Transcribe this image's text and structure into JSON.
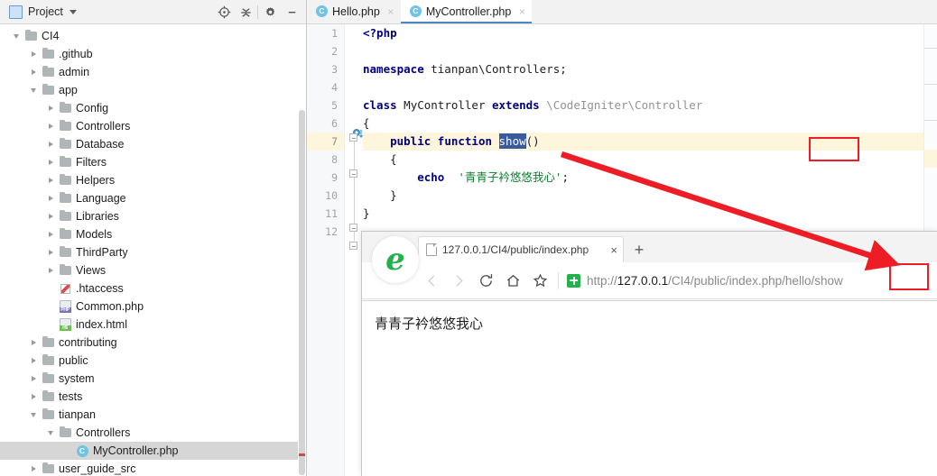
{
  "ide": {
    "sidebar": {
      "panel_title": "Project",
      "toolbar": [
        {
          "name": "locate-icon",
          "tooltip": "Select Opened File"
        },
        {
          "name": "collapse-all-icon",
          "tooltip": "Collapse All"
        },
        {
          "name": "gear-icon",
          "tooltip": "Settings"
        },
        {
          "name": "minimize-icon",
          "tooltip": "Hide"
        }
      ],
      "tree": [
        {
          "label": "CI4",
          "depth": 0,
          "kind": "folder",
          "state": "expanded",
          "selected": false
        },
        {
          "label": ".github",
          "depth": 1,
          "kind": "folder",
          "state": "collapsed",
          "selected": false
        },
        {
          "label": "admin",
          "depth": 1,
          "kind": "folder",
          "state": "collapsed",
          "selected": false
        },
        {
          "label": "app",
          "depth": 1,
          "kind": "folder",
          "state": "expanded",
          "selected": false
        },
        {
          "label": "Config",
          "depth": 2,
          "kind": "folder",
          "state": "collapsed",
          "selected": false
        },
        {
          "label": "Controllers",
          "depth": 2,
          "kind": "folder",
          "state": "collapsed",
          "selected": false
        },
        {
          "label": "Database",
          "depth": 2,
          "kind": "folder",
          "state": "collapsed",
          "selected": false
        },
        {
          "label": "Filters",
          "depth": 2,
          "kind": "folder",
          "state": "collapsed",
          "selected": false
        },
        {
          "label": "Helpers",
          "depth": 2,
          "kind": "folder",
          "state": "collapsed",
          "selected": false
        },
        {
          "label": "Language",
          "depth": 2,
          "kind": "folder",
          "state": "collapsed",
          "selected": false
        },
        {
          "label": "Libraries",
          "depth": 2,
          "kind": "folder",
          "state": "collapsed",
          "selected": false
        },
        {
          "label": "Models",
          "depth": 2,
          "kind": "folder",
          "state": "collapsed",
          "selected": false
        },
        {
          "label": "ThirdParty",
          "depth": 2,
          "kind": "folder",
          "state": "collapsed",
          "selected": false
        },
        {
          "label": "Views",
          "depth": 2,
          "kind": "folder",
          "state": "collapsed",
          "selected": false
        },
        {
          "label": ".htaccess",
          "depth": 2,
          "kind": "htaccess",
          "state": "leaf",
          "selected": false
        },
        {
          "label": "Common.php",
          "depth": 2,
          "kind": "php",
          "state": "leaf",
          "selected": false
        },
        {
          "label": "index.html",
          "depth": 2,
          "kind": "html",
          "state": "leaf",
          "selected": false
        },
        {
          "label": "contributing",
          "depth": 1,
          "kind": "folder",
          "state": "collapsed",
          "selected": false
        },
        {
          "label": "public",
          "depth": 1,
          "kind": "folder",
          "state": "collapsed",
          "selected": false
        },
        {
          "label": "system",
          "depth": 1,
          "kind": "folder",
          "state": "collapsed",
          "selected": false
        },
        {
          "label": "tests",
          "depth": 1,
          "kind": "folder",
          "state": "collapsed",
          "selected": false
        },
        {
          "label": "tianpan",
          "depth": 1,
          "kind": "folder",
          "state": "expanded",
          "selected": false
        },
        {
          "label": "Controllers",
          "depth": 2,
          "kind": "folder",
          "state": "expanded",
          "selected": false
        },
        {
          "label": "MyController.php",
          "depth": 3,
          "kind": "class",
          "state": "leaf",
          "selected": true
        },
        {
          "label": "user_guide_src",
          "depth": 1,
          "kind": "folder",
          "state": "collapsed",
          "selected": false
        }
      ]
    },
    "editor": {
      "tabs": [
        {
          "label": "Hello.php",
          "active": false,
          "icon": "php-class-icon",
          "close": "×"
        },
        {
          "label": "MyController.php",
          "active": true,
          "icon": "php-class-icon",
          "close": "×"
        }
      ],
      "line_numbers": [
        "1",
        "2",
        "3",
        "4",
        "5",
        "6",
        "7",
        "8",
        "9",
        "10",
        "11",
        "12"
      ],
      "current_line": 7,
      "code_lines": [
        {
          "n": 1,
          "tokens": [
            {
              "t": "<?php",
              "c": "kw"
            }
          ]
        },
        {
          "n": 2,
          "tokens": []
        },
        {
          "n": 3,
          "tokens": [
            {
              "t": "namespace",
              "c": "kw"
            },
            {
              "t": " tianpan\\Controllers;",
              "c": "ns"
            }
          ]
        },
        {
          "n": 4,
          "tokens": []
        },
        {
          "n": 5,
          "tokens": [
            {
              "t": "class",
              "c": "kw"
            },
            {
              "t": " MyController ",
              "c": "ns"
            },
            {
              "t": "extends",
              "c": "kw"
            },
            {
              "t": " ",
              "c": "ns"
            },
            {
              "t": "\\CodeIgniter\\Controller",
              "c": "cls"
            }
          ]
        },
        {
          "n": 6,
          "tokens": [
            {
              "t": "{",
              "c": "punc"
            }
          ]
        },
        {
          "n": 7,
          "tokens": [
            {
              "t": "    ",
              "c": "punc"
            },
            {
              "t": "public function",
              "c": "kw"
            },
            {
              "t": " ",
              "c": "punc"
            },
            {
              "t": "show",
              "c": "sel-show"
            },
            {
              "t": "()",
              "c": "punc"
            }
          ]
        },
        {
          "n": 8,
          "tokens": [
            {
              "t": "    {",
              "c": "punc"
            }
          ]
        },
        {
          "n": 9,
          "tokens": [
            {
              "t": "        ",
              "c": "punc"
            },
            {
              "t": "echo",
              "c": "kw"
            },
            {
              "t": "  ",
              "c": "punc"
            },
            {
              "t": "'青青子衿悠悠我心'",
              "c": "str"
            },
            {
              "t": ";",
              "c": "punc"
            }
          ]
        },
        {
          "n": 10,
          "tokens": [
            {
              "t": "    }",
              "c": "punc"
            }
          ]
        },
        {
          "n": 11,
          "tokens": [
            {
              "t": "}",
              "c": "punc"
            }
          ]
        },
        {
          "n": 12,
          "tokens": []
        }
      ]
    }
  },
  "browser": {
    "logo": "ie-360-browser-icon",
    "tab": {
      "title": "127.0.0.1/CI4/public/index.php",
      "favicon": "page-icon",
      "close_label": "×"
    },
    "new_tab_label": "+",
    "nav": [
      {
        "name": "back-icon",
        "label": "‹",
        "enabled": false
      },
      {
        "name": "forward-icon",
        "label": "›",
        "enabled": false
      },
      {
        "name": "reload-icon",
        "label": "↻",
        "enabled": true
      },
      {
        "name": "home-icon",
        "label": "⌂",
        "enabled": true
      },
      {
        "name": "bookmark-star-icon",
        "label": "☆",
        "enabled": true
      }
    ],
    "security_icon": "green-shield-icon",
    "url": {
      "prefix": "http://",
      "host": "127.0.0.1",
      "path": "/CI4/public/index.php/hello/",
      "highlighted_segment": "show",
      "full": "http://127.0.0.1/CI4/public/index.php/hello/show"
    },
    "page_text": "青青子衿悠悠我心"
  },
  "annotations": {
    "accent_color": "#ee1c25",
    "code_box_target": "show",
    "url_box_target": "show",
    "arrow": {
      "from": "code-show-box",
      "to": "url-show-box"
    }
  }
}
